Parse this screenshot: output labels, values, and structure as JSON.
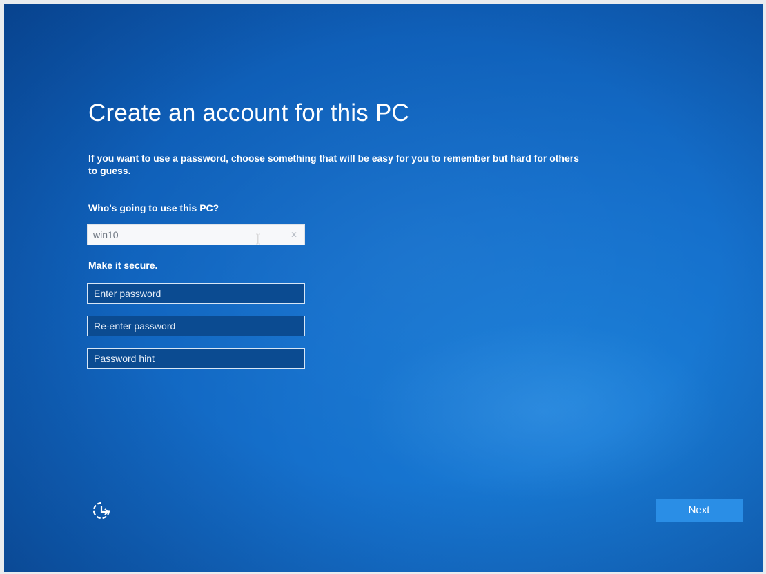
{
  "screen": {
    "title": "Create an account for this PC",
    "description": "If you want to use a password, choose something that will be easy for you to remember but hard for others to guess."
  },
  "user_section": {
    "label": "Who's going to use this PC?",
    "username_value": "win10"
  },
  "secure_section": {
    "label": "Make it secure.",
    "password_placeholder": "Enter password",
    "reenter_placeholder": "Re-enter password",
    "hint_placeholder": "Password hint"
  },
  "footer": {
    "next_label": "Next",
    "accessibility_icon": "ease-of-access-icon"
  },
  "colors": {
    "background": "#1570cc",
    "next_button": "#2a8ee6",
    "field_dark": "#0b4b91",
    "text": "#ffffff"
  }
}
